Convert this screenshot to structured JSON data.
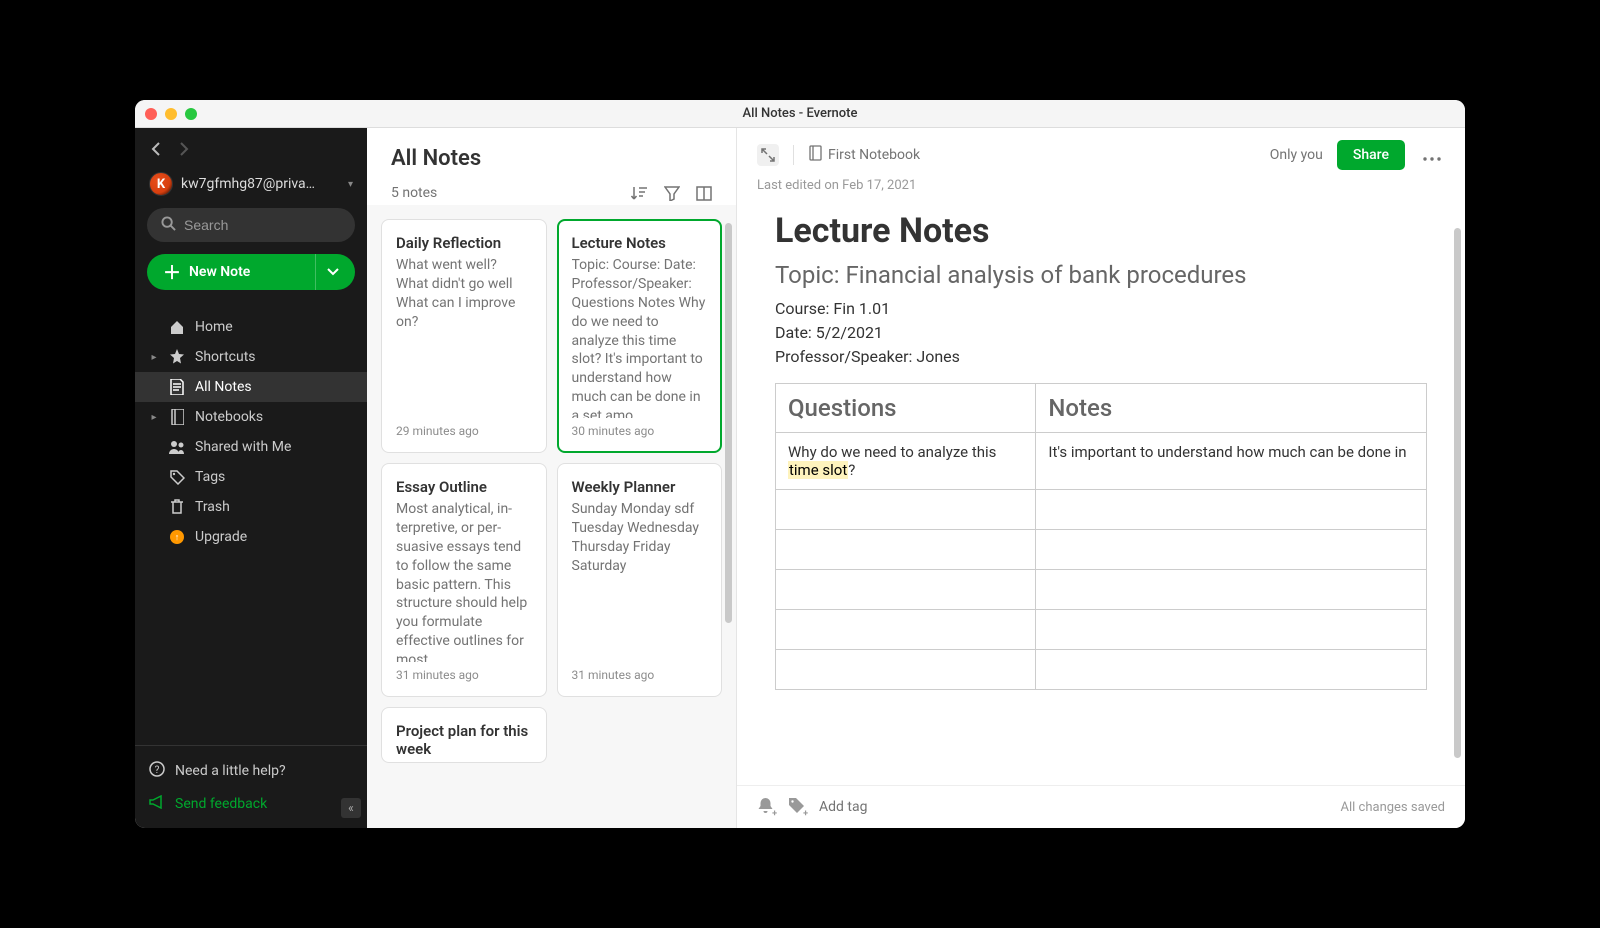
{
  "window": {
    "title": "All Notes - Evernote"
  },
  "sidebar": {
    "account_email": "kw7gfmhg87@priva…",
    "avatar_letter": "K",
    "search_placeholder": "Search",
    "new_note_label": "New Note",
    "items": [
      {
        "label": "Home"
      },
      {
        "label": "Shortcuts"
      },
      {
        "label": "All Notes"
      },
      {
        "label": "Notebooks"
      },
      {
        "label": "Shared with Me"
      },
      {
        "label": "Tags"
      },
      {
        "label": "Trash"
      },
      {
        "label": "Upgrade"
      }
    ],
    "help_label": "Need a little help?",
    "feedback_label": "Send feedback"
  },
  "notelist": {
    "title": "All Notes",
    "count_label": "5 notes",
    "cards": [
      {
        "title": "Daily Reflection",
        "preview": "What went well? What didn't go well What can I improve on?",
        "time": "29 minutes ago"
      },
      {
        "title": "Lecture Notes",
        "preview": "Topic: Course: Date: Professor/Speaker: Questions Notes Why do we need to analyze this time slot? It's important to understand how much can be done in a set amo…",
        "time": "30 minutes ago"
      },
      {
        "title": "Essay Outline",
        "preview": "Most analytical, in-terpretive, or per-suasive essays tend to follow the same basic pattern. This structure should help you formulate effective outlines for most …",
        "time": "31 minutes ago"
      },
      {
        "title": "Weekly Planner",
        "preview": "Sunday Monday sdf Tuesday Wednesday Thursday Friday Saturday",
        "time": "31 minutes ago"
      }
    ],
    "partial": {
      "title": "Project plan for this week"
    }
  },
  "editor": {
    "notebook": "First Notebook",
    "only_you": "Only you",
    "share": "Share",
    "last_edited": "Last edited on Feb 17, 2021",
    "note_title": "Lecture Notes",
    "topic_line": "Topic: Financial analysis of bank procedures",
    "course_line": "Course: Fin 1.01",
    "date_line": "Date: 5/2/2021",
    "prof_line": "Professor/Speaker: Jones",
    "th_questions": "Questions",
    "th_notes": "Notes",
    "q1_prefix": "Why do we need to analyze this ",
    "q1_mark": "time slot",
    "q1_suffix": "?",
    "n1": "It's important to understand how much can be done in",
    "footer": {
      "add_tag": "Add tag",
      "saved": "All changes saved"
    }
  }
}
